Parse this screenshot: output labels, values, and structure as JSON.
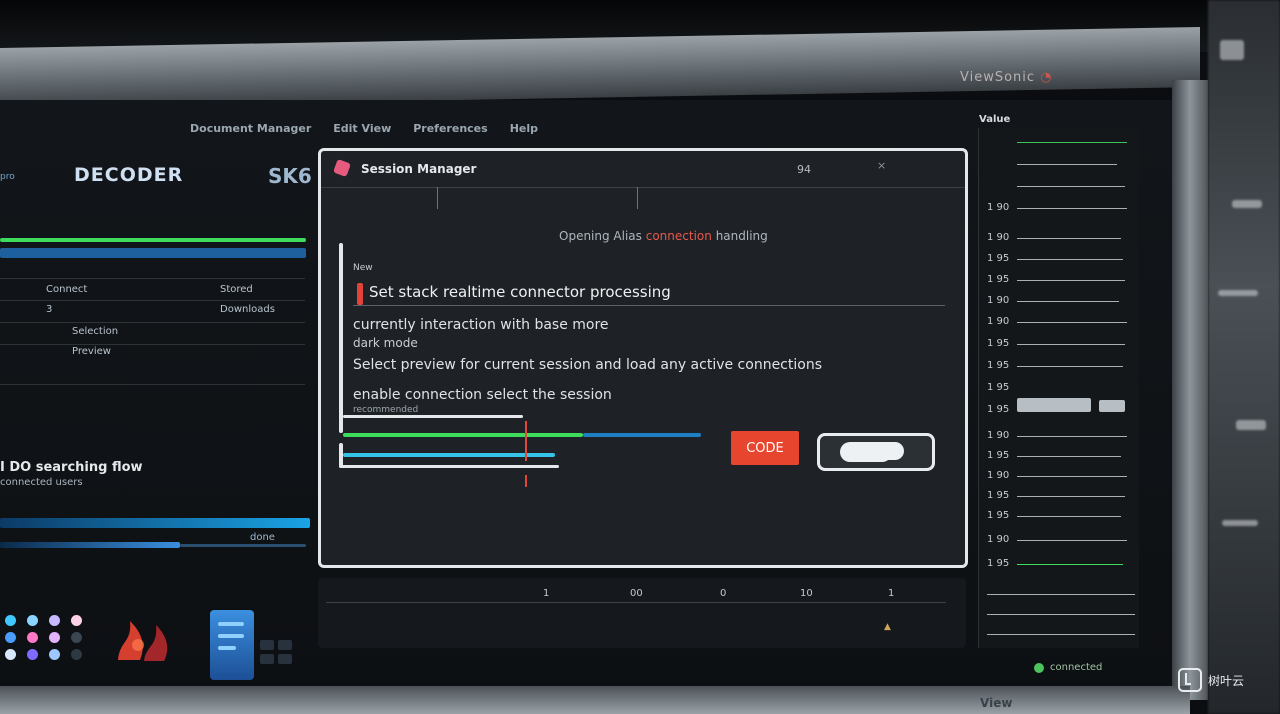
{
  "monitor": {
    "brand": "ViewSonic",
    "bottom_label": "View"
  },
  "menubar": {
    "items": [
      "Document Manager",
      "Edit View",
      "Preferences",
      "Help"
    ]
  },
  "left_panel": {
    "top_label": "pro",
    "logo": "DECODER",
    "logo_sub": "",
    "code": "SK6",
    "rows": [
      {
        "left": "Connect",
        "right": "Stored"
      },
      {
        "left": "3",
        "right": "Downloads"
      },
      {
        "left": "Selection",
        "right": ""
      },
      {
        "left": "Preview",
        "right": ""
      }
    ],
    "bottom_heading": "I DO searching flow",
    "bottom_sub": "connected users",
    "progress_label": "done"
  },
  "window": {
    "title": "Session Manager",
    "number": "94",
    "close_hint": "×"
  },
  "dialog": {
    "header_prefix": "Opening Alias",
    "header_accent": "connection",
    "header_suffix": "handling",
    "small_top": "New",
    "question": "Set stack realtime connector processing",
    "line1": "currently interaction with base",
    "line1_tail": "more",
    "line2": "dark mode",
    "line3": "Select preview for current session and load any active connections",
    "line4": "enable connection  select the session",
    "tiny": "recommended",
    "ok_label": "CODE",
    "toggle_label": ""
  },
  "timeline": {
    "ticks": [
      "1",
      "00",
      "0",
      "10",
      "1"
    ]
  },
  "right_panel": {
    "title": "Value",
    "rows": [
      "1 90",
      "1 90",
      "1 95",
      "1 95",
      "1 90",
      "1 90",
      "1 95",
      "1 95",
      "1 95",
      "1 95",
      "1 90",
      "1 95",
      "1 90",
      "1 95",
      "1 95",
      "1 90",
      "1 95"
    ],
    "footer": "connected"
  },
  "watermark": "树叶云",
  "colors": {
    "accent_red": "#e8452f",
    "accent_green": "#3ddc5c",
    "accent_blue": "#1aa3e6"
  }
}
